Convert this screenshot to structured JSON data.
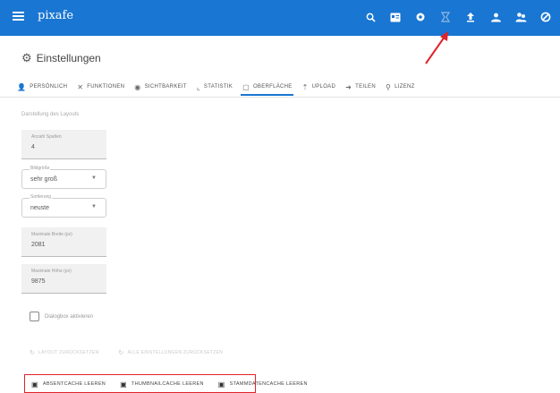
{
  "appbar": {
    "brand": "pixafe",
    "icons": [
      "search-icon",
      "id-card-icon",
      "settings-icon",
      "history-icon",
      "upload-icon",
      "people-icon",
      "users-icon",
      "logout-icon"
    ]
  },
  "page": {
    "title": "Einstellungen"
  },
  "tabs": [
    {
      "icon": "person-icon",
      "label": "PERSÖNLICH"
    },
    {
      "icon": "tools-icon",
      "label": "FUNKTIONEN"
    },
    {
      "icon": "eye-icon",
      "label": "SICHTBARKEIT"
    },
    {
      "icon": "chart-icon",
      "label": "STATISTIK"
    },
    {
      "icon": "window-icon",
      "label": "OBERFLÄCHE"
    },
    {
      "icon": "upload-icon",
      "label": "UPLOAD"
    },
    {
      "icon": "share-icon",
      "label": "TEILEN"
    },
    {
      "icon": "license-icon",
      "label": "LIZENZ"
    }
  ],
  "form": {
    "section_hint": "Darstellung des Layouts",
    "fields": {
      "columns": {
        "label": "Anzahl Spalten",
        "value": "4"
      },
      "size": {
        "label": "Bildgröße",
        "value": "sehr groß"
      },
      "sort": {
        "label": "Sortierung",
        "value": "neuste"
      },
      "width": {
        "label": "Maximale Breite (px)",
        "value": "2081"
      },
      "height": {
        "label": "Maximale Höhe (px)",
        "value": "9875"
      }
    },
    "checkbox_label": "Dialogbox aktivieren",
    "dim_buttons": [
      "LAYOUT ZURÜCKSETZEN",
      "ALLE EINSTELLUNGEN ZURÜCKSETZEN"
    ]
  },
  "actions": {
    "buttons": [
      "ABSENTCACHE LEEREN",
      "THUMBNAILCACHE LEEREN",
      "STAMMDATENCACHE LEEREN"
    ]
  },
  "colors": {
    "appbar": "#1976d2",
    "highlight": "#e0232b"
  }
}
